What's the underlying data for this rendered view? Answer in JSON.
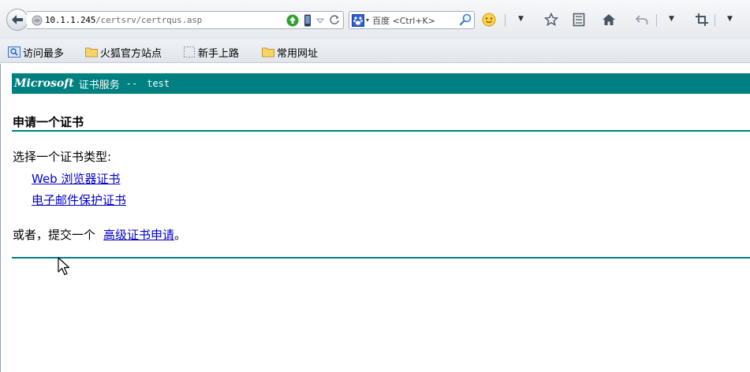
{
  "browser": {
    "url": {
      "host": "10.1.1.245",
      "path": "/certsrv/certrqus.asp"
    },
    "search": {
      "engine": "百度",
      "placeholder": "<Ctrl+K>"
    }
  },
  "bookmarks": [
    {
      "label": "访问最多",
      "icon": "most-visited-icon"
    },
    {
      "label": "火狐官方站点",
      "icon": "folder-icon"
    },
    {
      "label": "新手上路",
      "icon": "page-icon"
    },
    {
      "label": "常用网址",
      "icon": "folder-icon"
    }
  ],
  "page": {
    "header": {
      "brand": "Microsoft",
      "service": "证书服务",
      "separator": "--",
      "ca_name": "test"
    },
    "title": "申请一个证书",
    "prompt": "选择一个证书类型:",
    "links": {
      "web_browser_cert": "Web 浏览器证书",
      "email_protection_cert": "电子邮件保护证书"
    },
    "alternative": {
      "prefix": "或者，提交一个",
      "link": "高级证书申请",
      "suffix": "。"
    }
  },
  "colors": {
    "accent": "#008080",
    "link": "#0000cc"
  }
}
